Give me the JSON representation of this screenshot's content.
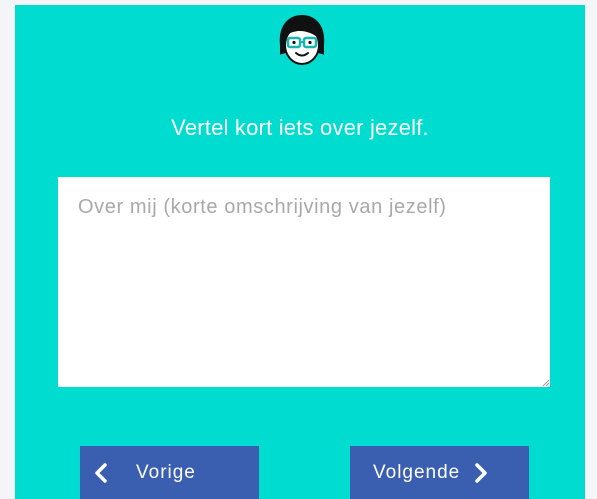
{
  "heading": "Vertel kort iets over jezelf.",
  "about_field": {
    "placeholder": "Over mij (korte omschrijving van jezelf)",
    "value": ""
  },
  "buttons": {
    "previous_label": "Vorige",
    "next_label": "Volgende"
  },
  "icons": {
    "avatar": "girl-with-glasses-avatar-icon",
    "previous": "chevron-left-icon",
    "next": "chevron-right-icon"
  },
  "colors": {
    "background": "#00dccf",
    "button": "#3a5fb0",
    "heading_text": "#ffffff"
  }
}
